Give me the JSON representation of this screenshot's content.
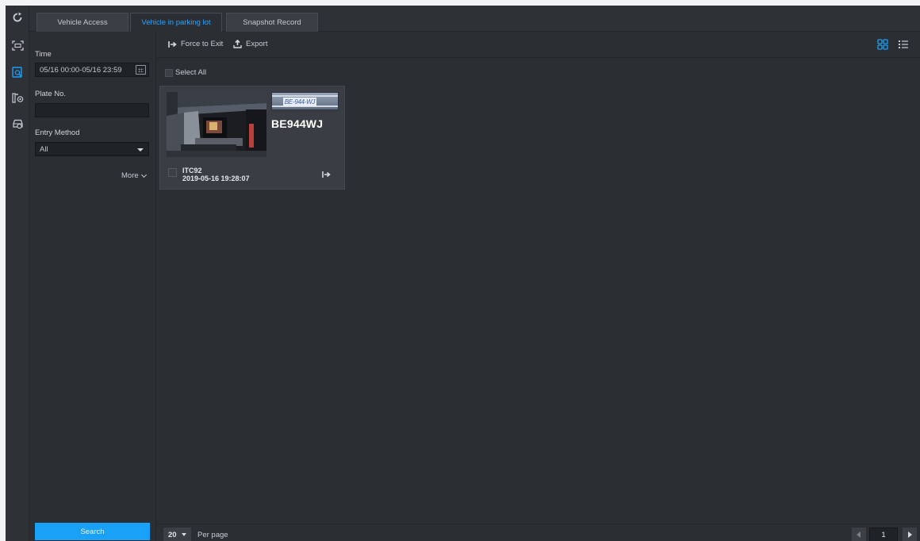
{
  "tabs": [
    {
      "label": "Vehicle Access"
    },
    {
      "label": "Vehicle in parking lot"
    },
    {
      "label": "Snapshot Record"
    }
  ],
  "active_tab": "Vehicle in parking lot",
  "rail": [
    "refresh-icon",
    "scan-frame-icon",
    "record-search-icon",
    "parking-gate-icon",
    "vehicle-icon"
  ],
  "filter": {
    "time_label": "Time",
    "time_value": "05/16 00:00-05/16 23:59",
    "plate_label": "Plate No.",
    "plate_value": "",
    "entry_label": "Entry Method",
    "entry_value": "All",
    "more_label": "More",
    "search_label": "Search"
  },
  "toolbar": {
    "force_exit_label": "Force to Exit",
    "export_label": "Export"
  },
  "select_all_label": "Select All",
  "records": [
    {
      "plate_image_text": "BE-944-WJ",
      "plate": "BE944WJ",
      "device": "ITC92",
      "time": "2019-05-16 19:28:07"
    }
  ],
  "pager": {
    "per_page_value": "20",
    "per_page_label": "Per page",
    "current_page": "1"
  },
  "colors": {
    "accent": "#19a0f7",
    "active_tab_text": "#29a5ff",
    "background": "#2b2e33",
    "card": "#3a3d43"
  }
}
